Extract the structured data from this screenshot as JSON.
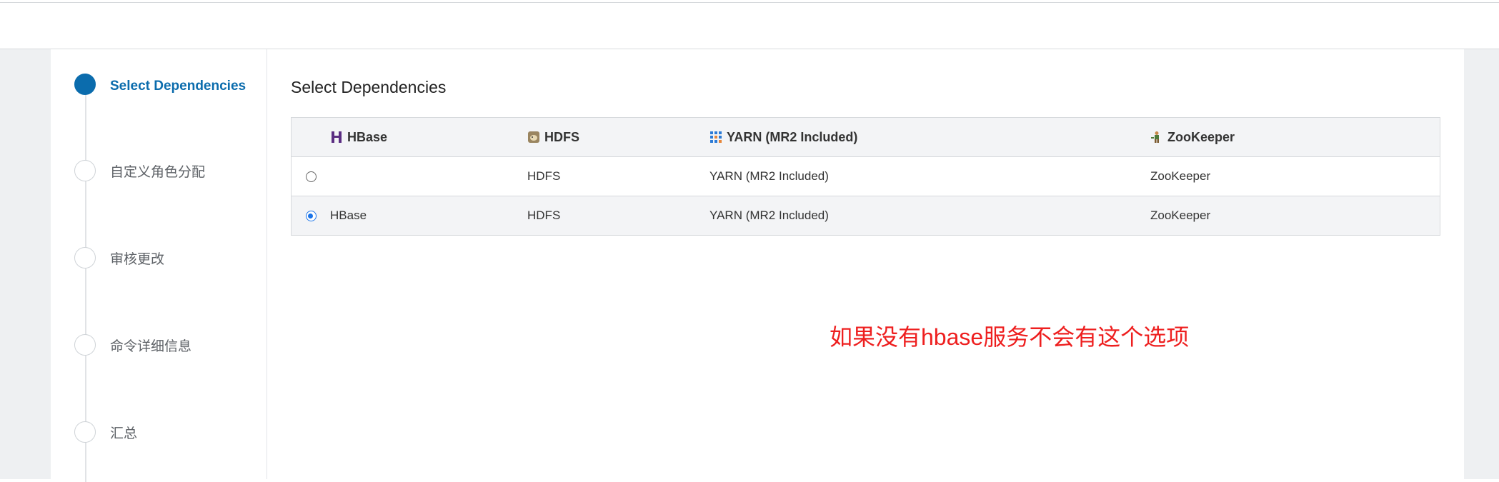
{
  "wizard": {
    "steps": [
      {
        "label": "Select Dependencies",
        "active": true
      },
      {
        "label": "自定义角色分配",
        "active": false
      },
      {
        "label": "审核更改",
        "active": false
      },
      {
        "label": "命令详细信息",
        "active": false
      },
      {
        "label": "汇总",
        "active": false
      }
    ]
  },
  "main": {
    "title": "Select Dependencies",
    "table": {
      "headers": [
        {
          "label": "HBase",
          "icon": "hbase-icon"
        },
        {
          "label": "HDFS",
          "icon": "hdfs-icon"
        },
        {
          "label": "YARN (MR2 Included)",
          "icon": "yarn-icon"
        },
        {
          "label": "ZooKeeper",
          "icon": "zookeeper-icon"
        }
      ],
      "rows": [
        {
          "selected": false,
          "hbase": "",
          "hdfs": "HDFS",
          "yarn": "YARN (MR2 Included)",
          "zookeeper": "ZooKeeper"
        },
        {
          "selected": true,
          "hbase": "HBase",
          "hdfs": "HDFS",
          "yarn": "YARN (MR2 Included)",
          "zookeeper": "ZooKeeper"
        }
      ]
    },
    "annotation": "如果没有hbase服务不会有这个选项"
  },
  "colors": {
    "accent": "#0b6cad",
    "annotation": "#ee1f1f",
    "header_bg": "#f3f4f6"
  }
}
